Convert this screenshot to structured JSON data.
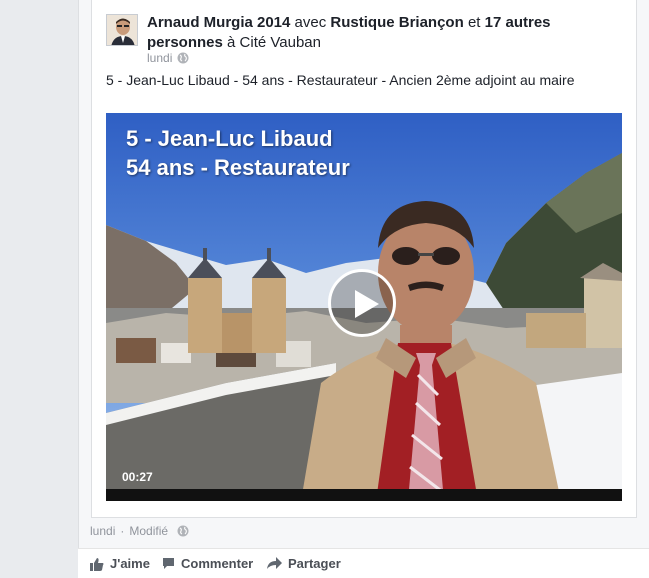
{
  "post": {
    "author": "Arnaud Murgia 2014",
    "with_word": "avec",
    "tagged": "Rustique Briançon",
    "and_word": "et",
    "others": "17 autres personnes",
    "at_word": "à",
    "place": "Cité Vauban",
    "time": "lundi",
    "message": "5 - Jean-Luc Libaud - 54 ans - Restaurateur - Ancien 2ème adjoint au maire"
  },
  "video": {
    "title_line1": "5 - Jean-Luc Libaud",
    "title_line2": "54 ans - Restaurateur",
    "duration": "00:27"
  },
  "meta": {
    "time": "lundi",
    "separator": "·",
    "edited": "Modifié"
  },
  "actions": {
    "like": "J'aime",
    "comment": "Commenter",
    "share": "Partager"
  },
  "icons": {
    "privacy": "globe-icon",
    "like": "thumbs-up-icon",
    "comment": "speech-bubble-icon",
    "share": "share-arrow-icon",
    "play": "play-icon"
  },
  "colors": {
    "background": "#e9ebee",
    "card": "#ffffff",
    "text": "#1d2129",
    "muted": "#90949c",
    "action_text": "#4b4f56"
  }
}
